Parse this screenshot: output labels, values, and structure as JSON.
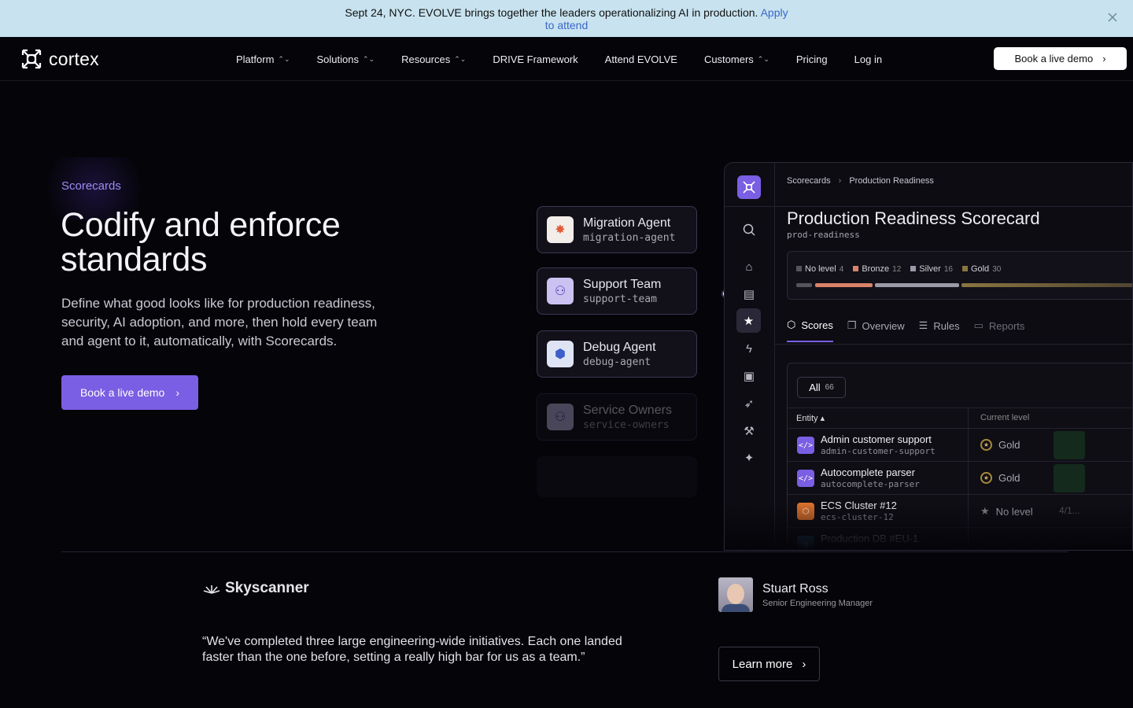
{
  "banner": {
    "text": "Sept 24, NYC. EVOLVE brings together the leaders operationalizing AI in production.",
    "link_part1": "Apply",
    "link_part2": "to attend"
  },
  "nav": {
    "brand": "cortex",
    "items": [
      {
        "label": "Platform",
        "dropdown": true
      },
      {
        "label": "Solutions",
        "dropdown": true
      },
      {
        "label": "Resources",
        "dropdown": true
      },
      {
        "label": "DRIVE Framework",
        "dropdown": false
      },
      {
        "label": "Attend EVOLVE",
        "dropdown": false
      },
      {
        "label": "Customers",
        "dropdown": true
      },
      {
        "label": "Pricing",
        "dropdown": false
      },
      {
        "label": "Log in",
        "dropdown": false
      }
    ],
    "cta": "Book a live demo"
  },
  "hero": {
    "eyebrow": "Scorecards",
    "title": "Codify and enforce standards",
    "lead": "Define what good looks like for production readiness, security, AI adoption, and more, then hold every team and agent to it, automatically, with Scorecards.",
    "cta": "Book a live demo"
  },
  "agents": [
    {
      "name": "Migration Agent",
      "slug": "migration-agent",
      "icon": "sunburst-icon",
      "color": "#e05c3a"
    },
    {
      "name": "Support Team",
      "slug": "support-team",
      "icon": "team-icon",
      "color": "#7a5ee3"
    },
    {
      "name": "Debug Agent",
      "slug": "debug-agent",
      "icon": "debug-icon",
      "color": "#5b7fe3"
    },
    {
      "name": "Service Owners",
      "slug": "service-owners",
      "icon": "team-icon",
      "color": "#7a5ee3"
    }
  ],
  "panel": {
    "breadcrumb": [
      "Scorecards",
      "Production Readiness"
    ],
    "title": "Production Readiness Scorecard",
    "slug": "prod-readiness",
    "levels": [
      {
        "label": "No level",
        "count": "4",
        "color": "#55545e"
      },
      {
        "label": "Bronze",
        "count": "12",
        "color": "#d9826a"
      },
      {
        "label": "Silver",
        "count": "16",
        "color": "#9a9aa6"
      },
      {
        "label": "Gold",
        "count": "30",
        "color": "#8a7540"
      }
    ],
    "tabs": [
      {
        "label": "Scores",
        "icon": "cube-icon"
      },
      {
        "label": "Overview",
        "icon": "window-icon"
      },
      {
        "label": "Rules",
        "icon": "list-icon"
      },
      {
        "label": "Reports",
        "icon": "report-icon"
      }
    ],
    "filter": {
      "label": "All",
      "count": "66"
    },
    "columns": [
      "Entity",
      "Current level"
    ],
    "rows": [
      {
        "name": "Admin customer support",
        "slug": "admin-customer-support",
        "level": "Gold",
        "icon_color": "#7a5ee3",
        "icon": "code-icon"
      },
      {
        "name": "Autocomplete parser",
        "slug": "autocomplete-parser",
        "level": "Gold",
        "icon_color": "#7a5ee3",
        "icon": "code-icon"
      },
      {
        "name": "ECS Cluster #12",
        "slug": "ecs-cluster-12",
        "level": "No level",
        "icon_color": "#e0722e",
        "icon": "hexagon-icon",
        "progress": "4/1..."
      },
      {
        "name": "Production DB #EU-1",
        "slug": "",
        "level": "",
        "icon_color": "#2d6b9a",
        "icon": "database-icon"
      }
    ]
  },
  "testimonial": {
    "company": "Skyscanner",
    "person": "Stuart Ross",
    "role": "Senior Engineering Manager",
    "quote": "“We've completed three large engineering-wide initiatives. Each one landed faster than the one before, setting a really high bar for us as a team.”",
    "cta": "Learn more"
  }
}
